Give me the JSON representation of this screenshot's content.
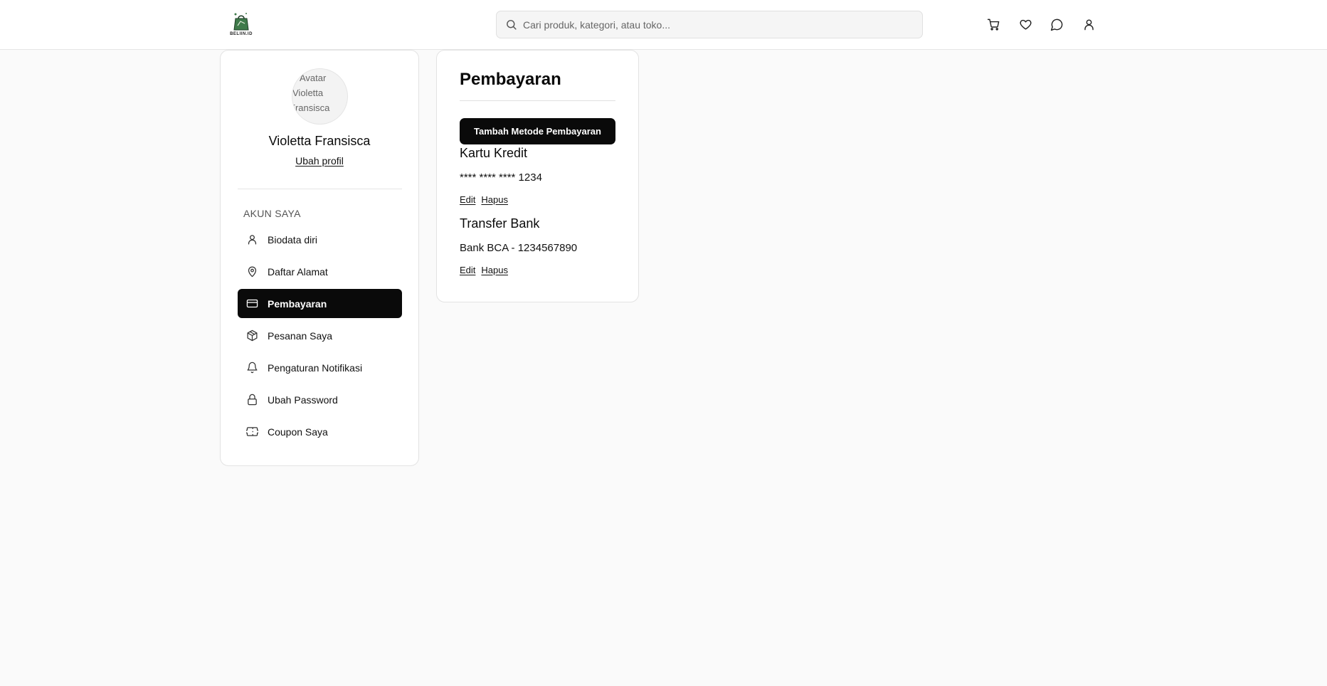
{
  "header": {
    "logo_text": "BELIIN.ID",
    "search_placeholder": "Cari produk, kategori, atau toko...",
    "icons": [
      "search-icon",
      "cart-icon",
      "heart-icon",
      "chat-icon",
      "user-icon"
    ]
  },
  "profile": {
    "avatar_alt_lines": [
      "Avatar",
      "Violetta",
      "Fransisca"
    ],
    "name": "Violetta Fransisca",
    "edit_link": "Ubah profil"
  },
  "sidebar": {
    "section_label": "AKUN SAYA",
    "items": [
      {
        "label": "Biodata diri",
        "icon": "user-icon",
        "active": false
      },
      {
        "label": "Daftar Alamat",
        "icon": "map-pin-icon",
        "active": false
      },
      {
        "label": "Pembayaran",
        "icon": "credit-card-icon",
        "active": true
      },
      {
        "label": "Pesanan Saya",
        "icon": "package-icon",
        "active": false
      },
      {
        "label": "Pengaturan Notifikasi",
        "icon": "bell-icon",
        "active": false
      },
      {
        "label": "Ubah Password",
        "icon": "lock-icon",
        "active": false
      },
      {
        "label": "Coupon Saya",
        "icon": "ticket-icon",
        "active": false
      }
    ]
  },
  "payment": {
    "title": "Pembayaran",
    "add_button": "Tambah Metode Pembayaran",
    "methods": [
      {
        "name": "Kartu Kredit",
        "detail": "**** **** **** 1234",
        "edit": "Edit",
        "delete": "Hapus"
      },
      {
        "name": "Transfer Bank",
        "detail": "Bank BCA - 1234567890",
        "edit": "Edit",
        "delete": "Hapus"
      }
    ]
  },
  "colors": {
    "background": "#fafafa",
    "accent": "#0a0a0a",
    "card": "#ffffff",
    "logo_green": "#3f7a4a"
  }
}
